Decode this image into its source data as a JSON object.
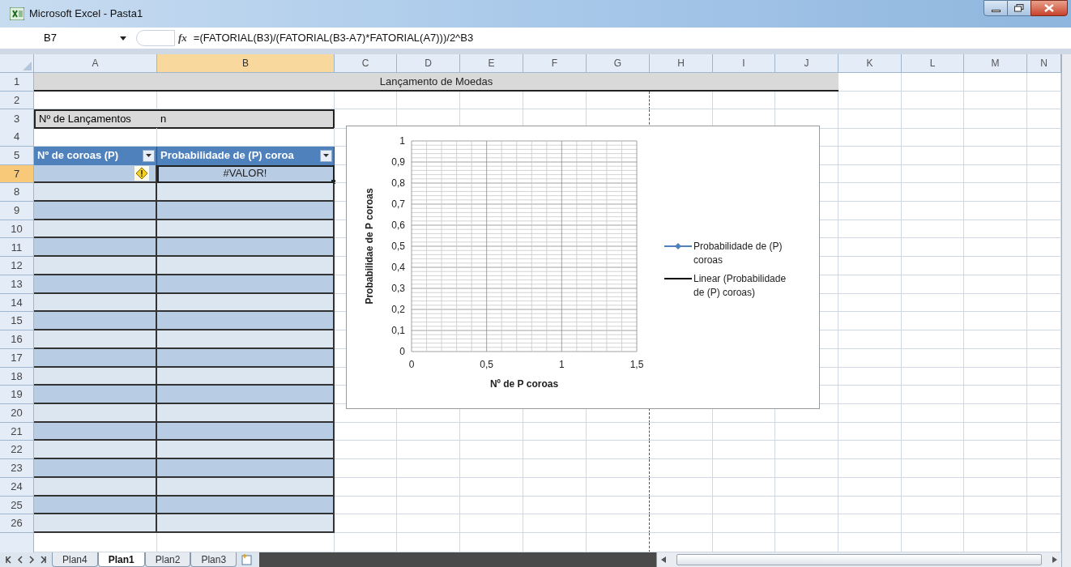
{
  "window": {
    "title": "Microsoft Excel - Pasta1"
  },
  "formula_bar": {
    "name_box": "B7",
    "function_label": "fx",
    "formula": "=(FATORIAL(B3)/(FATORIAL(B3-A7)*FATORIAL(A7)))/2^B3"
  },
  "columns": [
    {
      "label": "A",
      "selected": false
    },
    {
      "label": "B",
      "selected": true
    },
    {
      "label": "C",
      "selected": false
    },
    {
      "label": "D",
      "selected": false
    },
    {
      "label": "E",
      "selected": false
    },
    {
      "label": "F",
      "selected": false
    },
    {
      "label": "G",
      "selected": false
    },
    {
      "label": "H",
      "selected": false
    },
    {
      "label": "I",
      "selected": false
    },
    {
      "label": "J",
      "selected": false
    },
    {
      "label": "K",
      "selected": false
    },
    {
      "label": "L",
      "selected": false
    },
    {
      "label": "M",
      "selected": false
    },
    {
      "label": "N",
      "selected": false
    }
  ],
  "rows": [
    {
      "number": "1",
      "selected": false,
      "kind": "title",
      "text": "Lançamento de Moedas"
    },
    {
      "number": "2",
      "selected": false,
      "kind": "empty"
    },
    {
      "number": "3",
      "selected": false,
      "kind": "label",
      "cells": [
        "Nº de Lançamentos",
        "n"
      ]
    },
    {
      "number": "4",
      "selected": false,
      "kind": "empty"
    },
    {
      "number": "5",
      "selected": false,
      "kind": "header",
      "cells": [
        "Nº de coroas (P)",
        "Probabilidade de (P) coroa"
      ]
    },
    {
      "number": "7",
      "selected": true,
      "kind": "data",
      "warning": true,
      "active": true,
      "value": "#VALOR!"
    },
    {
      "number": "8",
      "selected": false,
      "kind": "data"
    },
    {
      "number": "9",
      "selected": false,
      "kind": "data"
    },
    {
      "number": "10",
      "selected": false,
      "kind": "data"
    },
    {
      "number": "11",
      "selected": false,
      "kind": "data"
    },
    {
      "number": "12",
      "selected": false,
      "kind": "data"
    },
    {
      "number": "13",
      "selected": false,
      "kind": "data"
    },
    {
      "number": "14",
      "selected": false,
      "kind": "data"
    },
    {
      "number": "15",
      "selected": false,
      "kind": "data"
    },
    {
      "number": "16",
      "selected": false,
      "kind": "data"
    },
    {
      "number": "17",
      "selected": false,
      "kind": "data"
    },
    {
      "number": "18",
      "selected": false,
      "kind": "data"
    },
    {
      "number": "19",
      "selected": false,
      "kind": "data"
    },
    {
      "number": "20",
      "selected": false,
      "kind": "data"
    },
    {
      "number": "21",
      "selected": false,
      "kind": "data"
    },
    {
      "number": "22",
      "selected": false,
      "kind": "data"
    },
    {
      "number": "23",
      "selected": false,
      "kind": "data"
    },
    {
      "number": "24",
      "selected": false,
      "kind": "data"
    },
    {
      "number": "25",
      "selected": false,
      "kind": "data"
    },
    {
      "number": "26",
      "selected": false,
      "kind": "data"
    }
  ],
  "chart": {
    "chart_data": {
      "type": "line",
      "xlabel": "Nº de P coroas",
      "ylabel": "Probabilidae de P coroas",
      "grid": true,
      "categories": [
        "0",
        "0,5",
        "1",
        "1,5"
      ],
      "series": [
        {
          "name": "Probabilidade de (P) coroas",
          "color": "#4f81bd",
          "marker": "diamond",
          "values": [
            null,
            null,
            null,
            null
          ]
        },
        {
          "name": "Linear (Probabilidade de (P) coroas)",
          "color": "#000000",
          "values": [
            null,
            null,
            null,
            null
          ]
        }
      ],
      "ylim": [
        0,
        1
      ],
      "yticks": [
        {
          "value": 0,
          "label": "0"
        },
        {
          "value": 0.1,
          "label": "0,1"
        },
        {
          "value": 0.2,
          "label": "0,2"
        },
        {
          "value": 0.3,
          "label": "0,3"
        },
        {
          "value": 0.4,
          "label": "0,4"
        },
        {
          "value": 0.5,
          "label": "0,5"
        },
        {
          "value": 0.6,
          "label": "0,6"
        },
        {
          "value": 0.7,
          "label": "0,7"
        },
        {
          "value": 0.8,
          "label": "0,8"
        },
        {
          "value": 0.9,
          "label": "0,9"
        },
        {
          "value": 1,
          "label": "1"
        }
      ]
    }
  },
  "sheet_tabs": [
    {
      "label": "Plan4",
      "selected": false
    },
    {
      "label": "Plan1",
      "selected": true
    },
    {
      "label": "Plan2",
      "selected": false
    },
    {
      "label": "Plan3",
      "selected": false
    }
  ]
}
